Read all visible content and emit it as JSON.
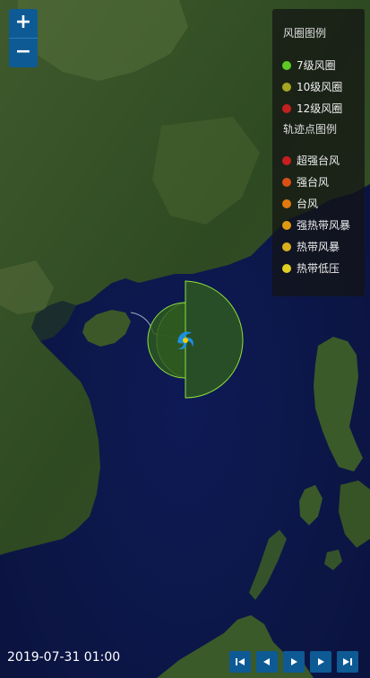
{
  "map": {
    "title": "typhoon-track-map",
    "colors": {
      "sea": "#0b1440",
      "land_dark": "#2d4a22",
      "land_light": "#4f6b36",
      "circle_fill": "#2e5a1e",
      "circle_stroke": "#8fe03a",
      "typhoon_icon": "#1c8fe0",
      "typhoon_core": "#f0d000"
    }
  },
  "zoom": {
    "in_label": "+",
    "out_label": "−"
  },
  "legend": {
    "wind_title": "风圈图例",
    "wind_items": [
      {
        "label": "7级风圈",
        "color": "#5ec925"
      },
      {
        "label": "10级风圈",
        "color": "#a6a620"
      },
      {
        "label": "12级风圈",
        "color": "#c32020"
      }
    ],
    "track_title": "轨迹点图例",
    "track_items": [
      {
        "label": "超强台风",
        "color": "#c81e1e"
      },
      {
        "label": "强台风",
        "color": "#d85015"
      },
      {
        "label": "台风",
        "color": "#e07a10"
      },
      {
        "label": "强热带风暴",
        "color": "#e09a10"
      },
      {
        "label": "热带风暴",
        "color": "#d8b020"
      },
      {
        "label": "热带低压",
        "color": "#e0d020"
      }
    ]
  },
  "time_label": "2019-07-31 01:00",
  "playback": {
    "buttons": [
      "first",
      "previous",
      "play",
      "next",
      "last"
    ],
    "icons": [
      "skip-start-icon",
      "step-back-icon",
      "play-icon",
      "step-forward-icon",
      "skip-end-icon"
    ]
  }
}
